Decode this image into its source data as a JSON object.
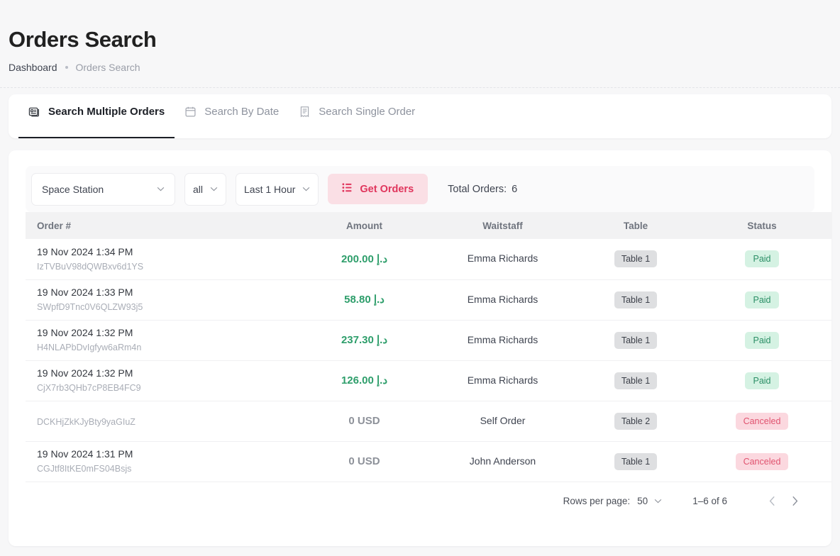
{
  "header": {
    "title": "Orders Search",
    "breadcrumb": {
      "parent": "Dashboard",
      "current": "Orders Search"
    }
  },
  "tabs": [
    {
      "label": "Search Multiple Orders",
      "icon": "multi-orders-icon",
      "active": true
    },
    {
      "label": "Search By Date",
      "icon": "calendar-icon",
      "active": false
    },
    {
      "label": "Search Single Order",
      "icon": "receipt-icon",
      "active": false
    }
  ],
  "filters": {
    "location": "Space Station",
    "scope": "all",
    "range": "Last 1 Hour",
    "get_orders_label": "Get Orders",
    "total_orders_label": "Total Orders:",
    "total_orders_value": "6"
  },
  "table": {
    "columns": [
      "Order #",
      "Amount",
      "Waitstaff",
      "Table",
      "Status"
    ],
    "rows": [
      {
        "date": "19 Nov 2024 1:34 PM",
        "id": "IzTVBuV98dQWBxv6d1YS",
        "amount": "200.00 د.إ",
        "amount_zero": false,
        "waitstaff": "Emma Richards",
        "table": "Table 1",
        "status": "Paid"
      },
      {
        "date": "19 Nov 2024 1:33 PM",
        "id": "SWpfD9Tnc0V6QLZW93j5",
        "amount": "58.80 د.إ",
        "amount_zero": false,
        "waitstaff": "Emma Richards",
        "table": "Table 1",
        "status": "Paid"
      },
      {
        "date": "19 Nov 2024 1:32 PM",
        "id": "H4NLAPbDvIgfyw6aRm4n",
        "amount": "237.30 د.إ",
        "amount_zero": false,
        "waitstaff": "Emma Richards",
        "table": "Table 1",
        "status": "Paid"
      },
      {
        "date": "19 Nov 2024 1:32 PM",
        "id": "CjX7rb3QHb7cP8EB4FC9",
        "amount": "126.00 د.إ",
        "amount_zero": false,
        "waitstaff": "Emma Richards",
        "table": "Table 1",
        "status": "Paid"
      },
      {
        "date": "",
        "id": "DCKHjZkKJyBty9yaGIuZ",
        "amount": "0 USD",
        "amount_zero": true,
        "waitstaff": "Self Order",
        "table": "Table 2",
        "status": "Canceled"
      },
      {
        "date": "19 Nov 2024 1:31 PM",
        "id": "CGJtf8ItKE0mFS04Bsjs",
        "amount": "0 USD",
        "amount_zero": true,
        "waitstaff": "John Anderson",
        "table": "Table 1",
        "status": "Canceled"
      }
    ]
  },
  "pagination": {
    "rows_per_page_label": "Rows per page:",
    "rows_per_page_value": "50",
    "range": "1–6 of 6",
    "prev_icon": "chevron-left-icon",
    "next_icon": "chevron-right-icon"
  },
  "colors": {
    "accent_pink": "#e0355c",
    "accent_pink_bg": "#fadfe5",
    "paid_text": "#2b8f66",
    "paid_bg": "#d5f2e3",
    "canceled_text": "#e0536f",
    "canceled_bg": "#fbd8df",
    "amount_green": "#2e9e6b",
    "page_bg": "#f7f7f8"
  }
}
